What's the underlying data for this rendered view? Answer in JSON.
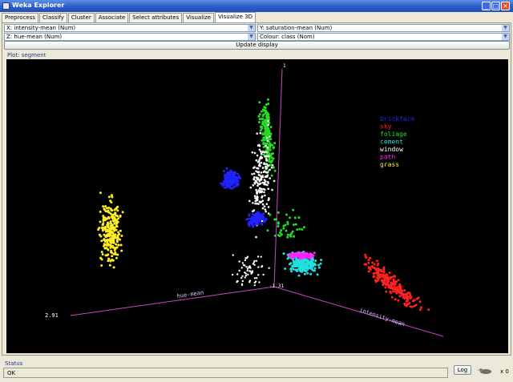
{
  "window": {
    "title": "Weka Explorer",
    "controls": {
      "minimize": "_",
      "maximize": "□",
      "close": "×"
    }
  },
  "tabs": [
    {
      "label": "Preprocess",
      "active": false
    },
    {
      "label": "Classify",
      "active": false
    },
    {
      "label": "Cluster",
      "active": false
    },
    {
      "label": "Associate",
      "active": false
    },
    {
      "label": "Select attributes",
      "active": false
    },
    {
      "label": "Visualize",
      "active": false
    },
    {
      "label": "Visualize 3D",
      "active": true
    }
  ],
  "controls": {
    "x_axis": "X: intensity-mean (Num)",
    "y_axis": "Y: saturation-mean (Num)",
    "z_axis": "Z: hue-mean (Num)",
    "colour": "Colour: class (Nom)",
    "update_button": "Update display"
  },
  "plot": {
    "label": "Plot: segment",
    "axis_labels": {
      "intensity": "intensity-mean",
      "hue": "hue-mean",
      "saturation": "1",
      "origin": "-1.31",
      "corner": "2.91"
    },
    "legend": [
      {
        "label": "brickface",
        "color": "#2222ff"
      },
      {
        "label": "sky",
        "color": "#ff2020"
      },
      {
        "label": "foliage",
        "color": "#22dd22"
      },
      {
        "label": "cement",
        "color": "#22e0e0"
      },
      {
        "label": "window",
        "color": "#ffffff"
      },
      {
        "label": "path",
        "color": "#ff22ff"
      },
      {
        "label": "grass",
        "color": "#ffee22"
      }
    ],
    "axis_color": "#cc44cc"
  },
  "status": {
    "title": "Status",
    "text": "OK",
    "log_button": "Log",
    "task_count": "x 0"
  }
}
